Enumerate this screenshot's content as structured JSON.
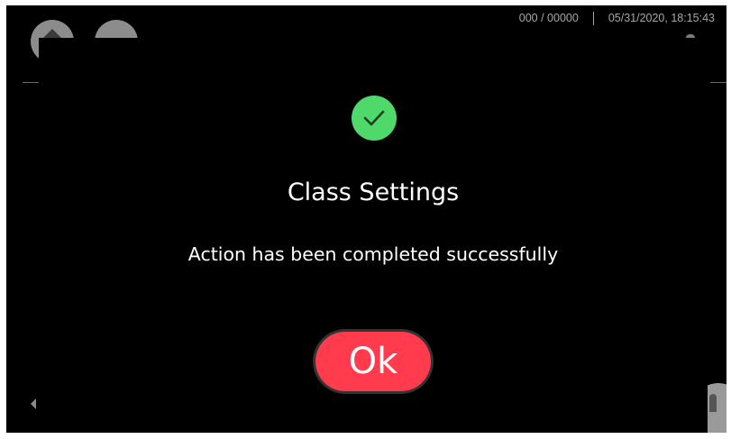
{
  "status_bar": {
    "counter": "000 / 00000",
    "datetime": "05/31/2020, 18:15:43"
  },
  "dialog": {
    "icon": "check-circle-icon",
    "title": "Class Settings",
    "message": "Action has been completed successfully",
    "ok_label": "Ok"
  },
  "colors": {
    "background": "#000000",
    "success": "#4fd96a",
    "ok_button": "#ff3b4d",
    "text": "#ffffff",
    "status_text": "#a8a8a8"
  }
}
